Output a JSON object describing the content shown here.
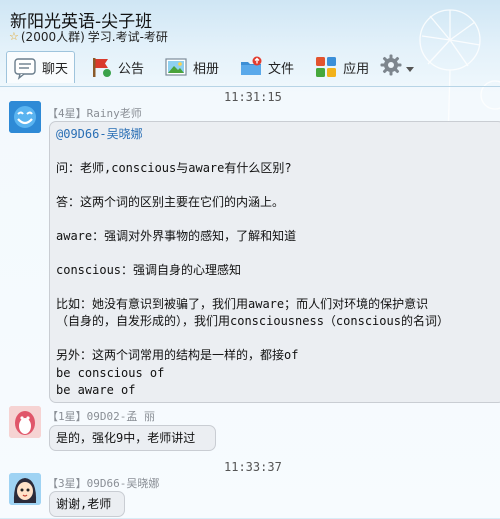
{
  "window": {
    "group_name": "新阳光英语-尖子班",
    "member_count": "(2000人群)",
    "tags": "学习.考试-考研"
  },
  "toolbar": {
    "chat": "聊天",
    "announcement": "公告",
    "album": "相册",
    "files": "文件",
    "apps": "应用"
  },
  "timestamps": {
    "first": "11:31:15",
    "second": "11:33:37"
  },
  "messages": [
    {
      "sender": "【4星】Rainy老师",
      "lines": [
        "@09D66-吴晓娜",
        "",
        "问：老师,conscious与aware有什么区别?",
        "",
        "答：这两个词的区别主要在它们的内涵上。",
        "",
        "aware：强调对外界事物的感知，了解和知道",
        "",
        "conscious：强调自身的心理感知",
        "",
        "比如：她没有意识到被骗了，我们用aware；而人们对环境的保护意识",
        "（自身的，自发形成的），我们用consciousness（conscious的名词）",
        "",
        "另外：这两个词常用的结构是一样的，都接of",
        "be conscious of",
        "be aware of"
      ]
    },
    {
      "sender": "【1星】09D02-孟    丽",
      "lines": [
        "是的，强化9中，老师讲过"
      ]
    },
    {
      "sender": "【3星】09D66-吴晓娜",
      "lines": [
        "谢谢,老师"
      ]
    }
  ],
  "colors": {
    "bubble_bg": "#ebeef2",
    "bubble_border": "#c9cdd3",
    "mention": "#2a6fb5",
    "sender_gray": "#8a8f96"
  }
}
